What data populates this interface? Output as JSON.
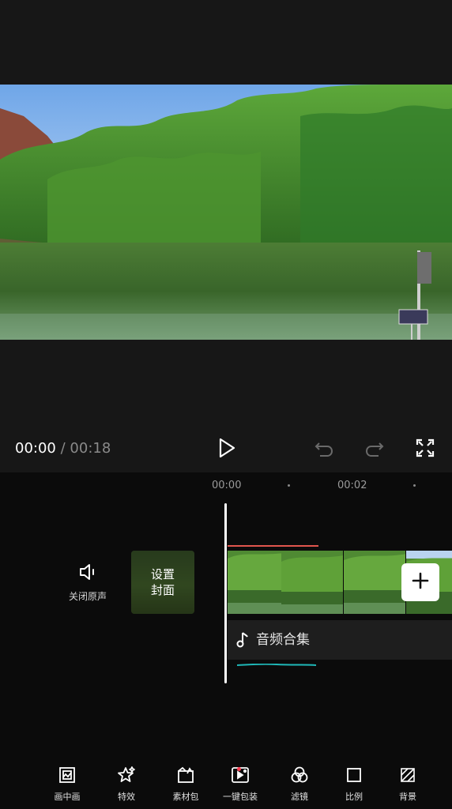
{
  "player": {
    "current_time": "00:00",
    "separator": "/",
    "total_time": "00:18"
  },
  "timeline": {
    "ruler": [
      "00:00",
      "00:02"
    ],
    "mute_label": "关闭原声",
    "cover_label_line1": "设置",
    "cover_label_line2": "封面",
    "audio_label": "音频合集"
  },
  "toolbar": {
    "items": [
      {
        "label": "画中画",
        "icon": "picture-in-picture-icon"
      },
      {
        "label": "特效",
        "icon": "effects-star-icon"
      },
      {
        "label": "素材包",
        "icon": "material-pack-icon"
      },
      {
        "label": "一键包装",
        "icon": "one-click-package-icon"
      },
      {
        "label": "滤镜",
        "icon": "filter-icon"
      },
      {
        "label": "比例",
        "icon": "ratio-icon"
      },
      {
        "label": "背景",
        "icon": "background-icon"
      }
    ]
  },
  "colors": {
    "accent_red": "#e0554d",
    "audio_wave": "#1fb8b8"
  }
}
